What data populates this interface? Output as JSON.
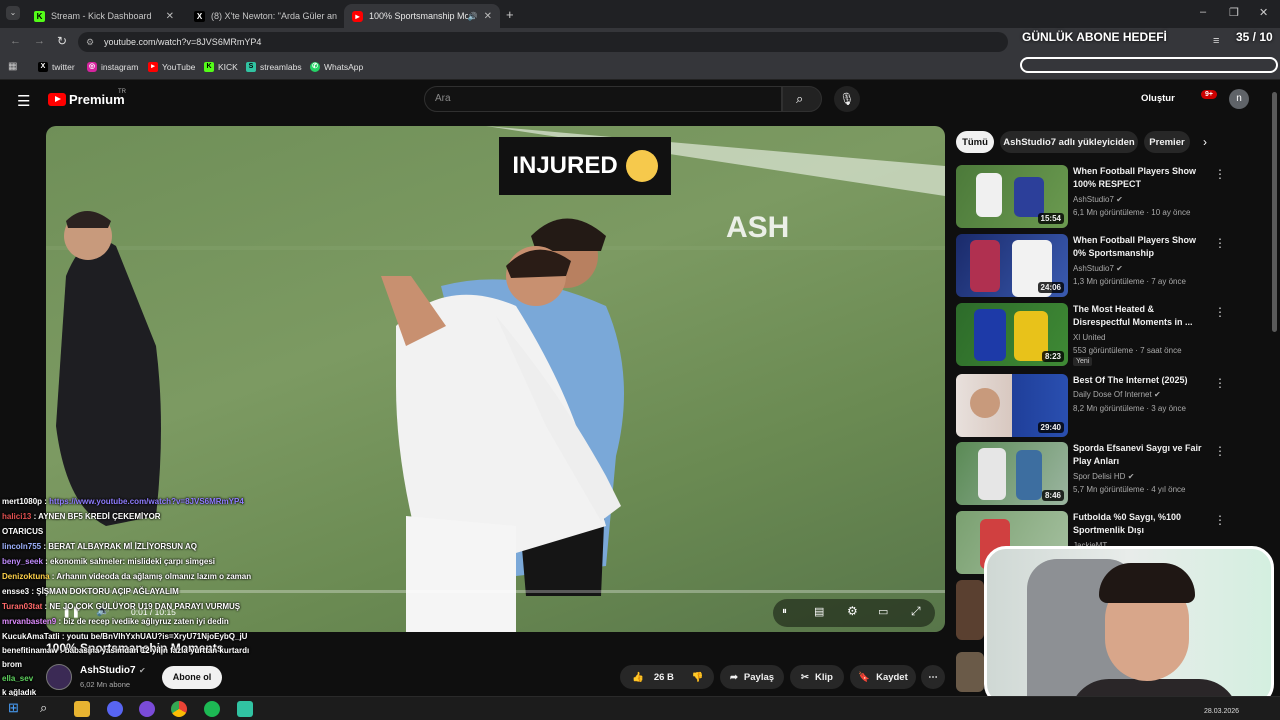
{
  "tabs": [
    {
      "label": "Stream - Kick Dashboard"
    },
    {
      "label": "(8) X'te Newton: \"Arda Güler an"
    },
    {
      "label": "100% Sportsmanship Mome"
    }
  ],
  "url": "youtube.com/watch?v=8JVS6MRmYP4",
  "bookmarks": [
    "twitter",
    "instagram",
    "YouTube",
    "KICK",
    "streamlabs",
    "WhatsApp"
  ],
  "overlay": {
    "title": "GÜNLÜK ABONE HEDEFİ",
    "count": "35 / 10"
  },
  "yt": {
    "logo": "Premium",
    "logo_sup": "TR",
    "search_placeholder": "Ara",
    "create": "Oluştur",
    "notif": "9+",
    "avatar": "n"
  },
  "video": {
    "banner": "INJURED",
    "watermark": "ASH",
    "time": "0:01 / 10:15",
    "title": "100% Sportsmanship Moments"
  },
  "channel": {
    "name": "AshStudio7",
    "subs": "6,02 Mn abone",
    "subscribe": "Abone ol"
  },
  "actions": {
    "likes": "26 B",
    "share": "Paylaş",
    "clip": "Klip",
    "save": "Kaydet"
  },
  "chips": [
    "Tümü",
    "AshStudio7 adlı yükleyiciden",
    "Premier"
  ],
  "recs": [
    {
      "title": "When Football Players Show 100% RESPECT",
      "channel": "AshStudio7",
      "meta": "6,1 Mn görüntüleme · 10 ay önce",
      "dur": "15:54"
    },
    {
      "title": "When Football Players Show 0% Sportsmanship",
      "channel": "AshStudio7",
      "meta": "1,3 Mn görüntüleme · 7 ay önce",
      "dur": "24:06"
    },
    {
      "title": "The Most Heated & Disrespectful Moments in ...",
      "channel": "Xl United",
      "meta": "553 görüntüleme · 7 saat önce",
      "badge": "Yeni",
      "dur": "8:23"
    },
    {
      "title": "Best Of The Internet (2025)",
      "channel": "Daily Dose Of Internet",
      "meta": "8,2 Mn görüntüleme · 3 ay önce",
      "dur": "29:40"
    },
    {
      "title": "Sporda Efsanevi Saygı ve Fair Play Anları",
      "channel": "Spor Delisi HD",
      "meta": "5,7 Mn görüntüleme · 4 yıl önce",
      "dur": "8:46"
    },
    {
      "title": "Futbolda %0 Saygı, %100 Sportmenlik Dışı",
      "channel": "JackieMT",
      "meta": "",
      "dur": ""
    }
  ],
  "chat": [
    {
      "user": "mert1080p",
      "msg": "https://www.youtube.com/watch?v=8JVS6MRmYP4",
      "ucolor": "#ffffff",
      "mcolor": "#8f7cff"
    },
    {
      "user": "halici13",
      "msg": "AYNEN BF5 KREDİ ÇEKEMİYOR",
      "ucolor": "#e05050",
      "mcolor": "#ffffff"
    },
    {
      "user": "OTARICUS",
      "msg": "",
      "ucolor": "#ffffff",
      "mcolor": "#ffffff"
    },
    {
      "user": "lincoln755",
      "msg": "BERAT ALBAYRAK Mİ İZLİYORSUN AQ",
      "ucolor": "#9fb3ff",
      "mcolor": "#ffffff"
    },
    {
      "user": "beny_seek",
      "msg": "ekonomik sahneler: mislideki çarpı simgesi",
      "ucolor": "#c28cff",
      "mcolor": "#ffffff"
    },
    {
      "user": "Denizoktuna",
      "msg": "Arhanın videoda da ağlamış olmanız lazım o zaman",
      "ucolor": "#ffd24a",
      "mcolor": "#ffffff"
    },
    {
      "user": "ensse3",
      "msg": "ŞİŞMAN DOKTORU AÇIP AĞLAYALIM",
      "ucolor": "#ffffff",
      "mcolor": "#ffffff"
    },
    {
      "user": "Turan03tat",
      "msg": "NE JO ÇOK GÜLÜYOR U19 DAN PARAYI VURMUŞ",
      "ucolor": "#ff6a6a",
      "mcolor": "#ffffff"
    },
    {
      "user": "mrvanbasten9",
      "msg": "biz de recep ivedike ağlıyruz zaten iyi dedin",
      "ucolor": "#e08cff",
      "mcolor": "#ffffff"
    },
    {
      "user": "KucukAmaTatli",
      "msg": "youtu be/BnVlhYxhUAU?is=XryU71NjoEybQ_jU",
      "ucolor": "#ffffff",
      "mcolor": "#ffffff"
    },
    {
      "user": "benefitinamaw",
      "msg": "babasina yasimdan 12 yilin fazla yurttan kurtardı",
      "ucolor": "#ffffff",
      "mcolor": "#ffffff"
    },
    {
      "user": "brom",
      "msg": "",
      "ucolor": "#ffffff",
      "mcolor": "#ffffff"
    },
    {
      "user": "ella_sev",
      "msg": "",
      "ucolor": "#5fd35f",
      "mcolor": "#ffffff"
    },
    {
      "user": "k ağladık",
      "msg": "",
      "ucolor": "#ffffff",
      "mcolor": "#ffffff"
    }
  ],
  "date": "28.03.2026"
}
